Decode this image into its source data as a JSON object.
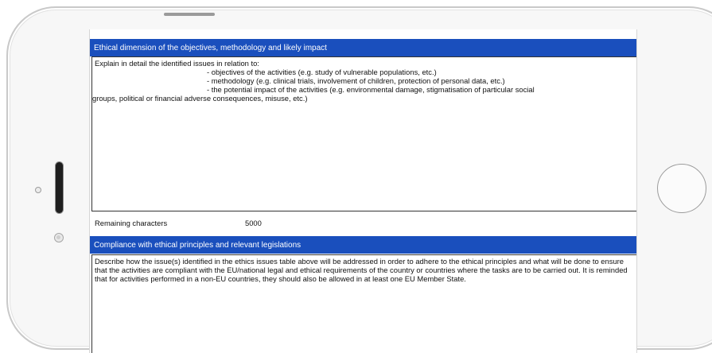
{
  "section1": {
    "header": "Ethical dimension of the objectives, methodology and likely impact",
    "intro": "Explain in detail the identified issues in relation to:",
    "bullets": [
      "- objectives of the activities (e.g. study of vulnerable populations, etc.)",
      "- methodology (e.g. clinical trials, involvement of children, protection of personal data, etc.)",
      "- the potential impact of the activities (e.g. environmental damage, stigmatisation of particular social"
    ],
    "continuation": "groups, political or financial adverse consequences, misuse, etc.)"
  },
  "remaining": {
    "label": "Remaining characters",
    "value": "5000"
  },
  "section2": {
    "header": "Compliance with ethical principles and relevant legislations",
    "body": "Describe how the issue(s) identified in the ethics issues table above will be addressed in order to adhere to the ethical principles and what will be done to ensure that the activities are compliant with the EU/national legal and ethical requirements of the country or countries where the tasks are to be carried out. It is reminded that for activities performed in a non-EU countries, they should also be allowed in at least one EU Member State."
  }
}
